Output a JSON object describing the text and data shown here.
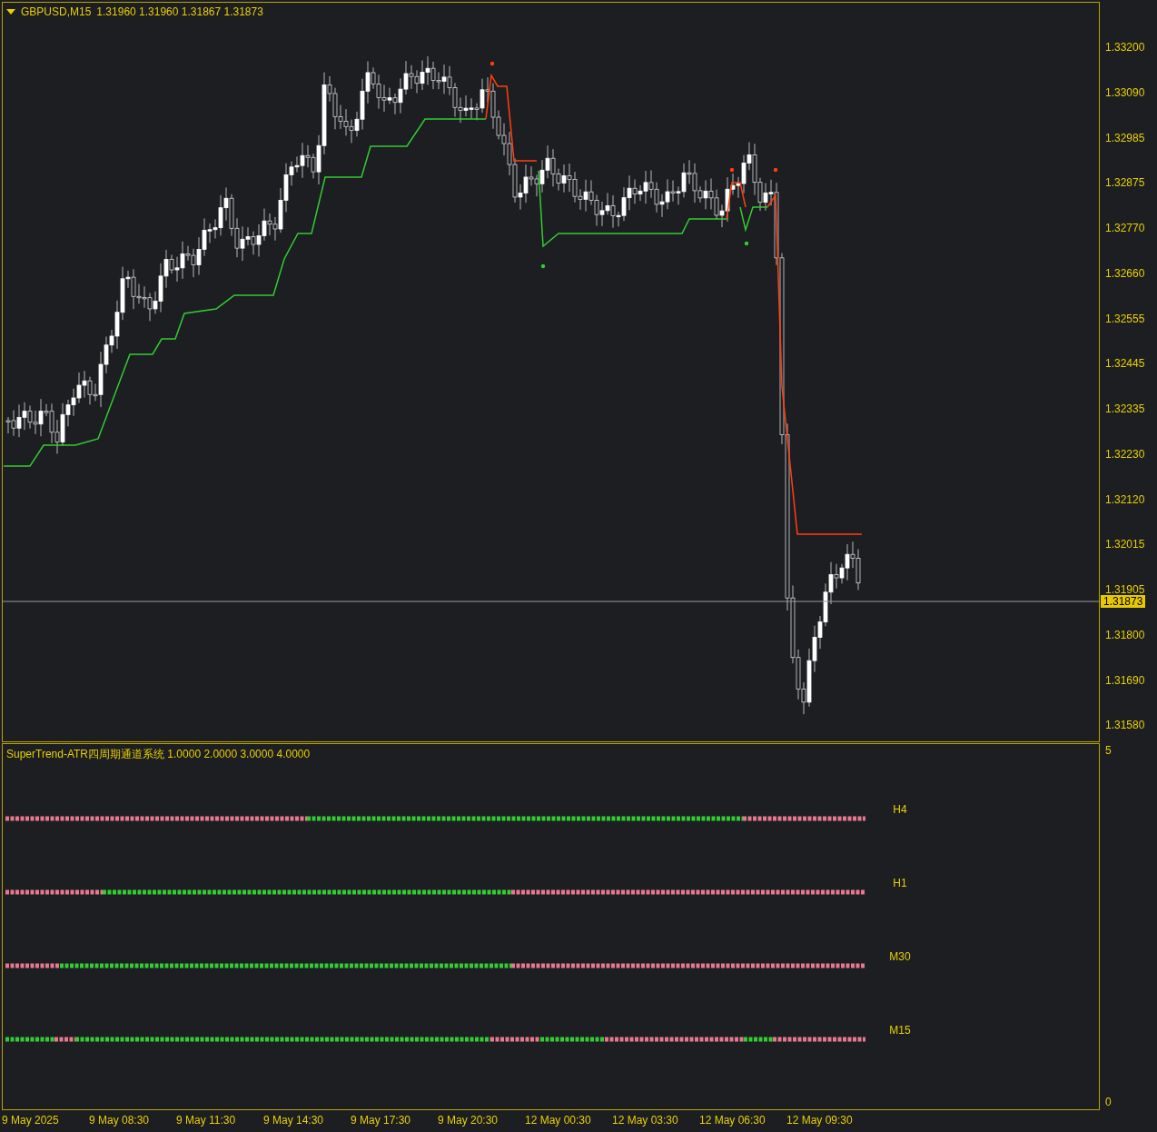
{
  "chart_header": {
    "symbol": "GBPUSD,M15",
    "quotes": [
      "1.31960",
      "1.31960",
      "1.31867",
      "1.31873"
    ]
  },
  "price_axis": {
    "ticks": [
      "1.33200",
      "1.33090",
      "1.32985",
      "1.32875",
      "1.32770",
      "1.32660",
      "1.32555",
      "1.32445",
      "1.32335",
      "1.32230",
      "1.32120",
      "1.32015",
      "1.31905",
      "1.31800",
      "1.31690",
      "1.31580"
    ],
    "current_price": "1.31873"
  },
  "indicator": {
    "title": "SuperTrend-ATR四周期通道系统 1.0000 2.0000 3.0000 4.0000",
    "axis": [
      "5",
      "0"
    ],
    "rows": [
      {
        "label": "H4"
      },
      {
        "label": "H1"
      },
      {
        "label": "M30"
      },
      {
        "label": "M15"
      }
    ]
  },
  "time_axis": [
    "9 May 2025",
    "9 May 08:30",
    "9 May 11:30",
    "9 May 14:30",
    "9 May 17:30",
    "9 May 20:30",
    "12 May 00:30",
    "12 May 03:30",
    "12 May 06:30",
    "12 May 09:30"
  ]
}
